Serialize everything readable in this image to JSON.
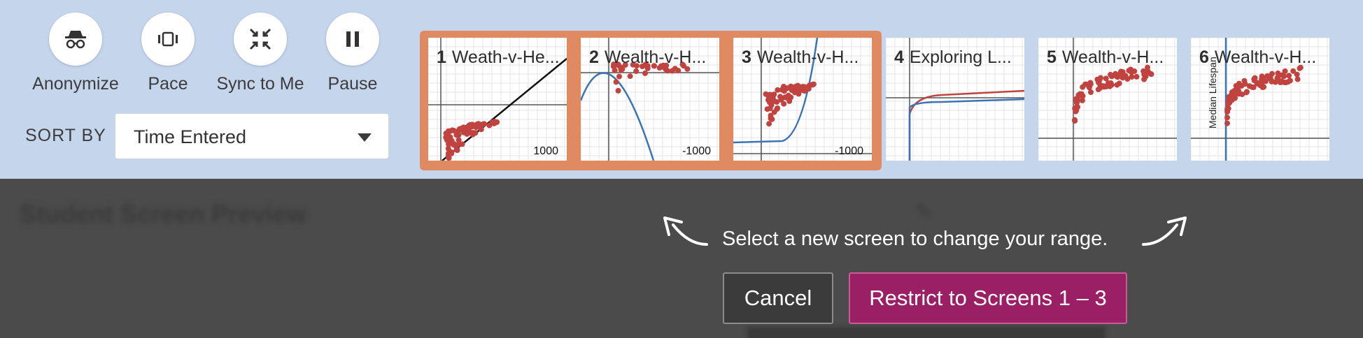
{
  "controls": [
    {
      "label": "Anonymize",
      "icon": "incognito-icon"
    },
    {
      "label": "Pace",
      "icon": "pace-icon"
    },
    {
      "label": "Sync to Me",
      "icon": "sync-arrows-icon"
    },
    {
      "label": "Pause",
      "icon": "pause-icon"
    }
  ],
  "sort": {
    "label": "SORT BY",
    "value": "Time Entered"
  },
  "screens": [
    {
      "number": "1",
      "title": "Weath-v-He...",
      "tick": "1000",
      "curve": "line"
    },
    {
      "number": "2",
      "title": "Wealth-v-H...",
      "tick": "-1000",
      "curve": "parabola"
    },
    {
      "number": "3",
      "title": "Wealth-v-H...",
      "tick": "-1000",
      "curve": "exponential"
    },
    {
      "number": "4",
      "title": "Exploring L...",
      "tick": "",
      "curve": "log"
    },
    {
      "number": "5",
      "title": "Wealth-v-H...",
      "tick": "",
      "curve": "none"
    },
    {
      "number": "6",
      "title": "Wealth-v-H...",
      "tick": "",
      "curve": "none",
      "axis_label": "Median Lifespan"
    }
  ],
  "selected_range": {
    "start": 1,
    "end": 3
  },
  "overlay": {
    "hint": "Select a new screen to change your range.",
    "cancel": "Cancel",
    "restrict": "Restrict to Screens 1 – 3"
  },
  "colors": {
    "toolbar_bg": "#c5d5ec",
    "range_highlight": "#df8a60",
    "restrict_button": "#9a1f64",
    "scatter_points": "#c0433f",
    "curve_blue": "#3b73b9"
  }
}
